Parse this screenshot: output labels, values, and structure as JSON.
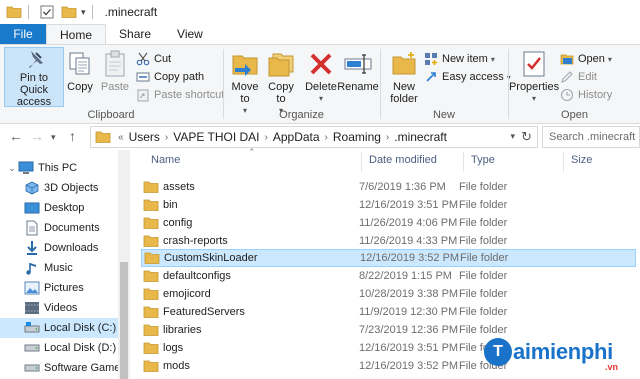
{
  "window": {
    "title": ".minecraft"
  },
  "tabs": [
    {
      "label": "File",
      "active": false
    },
    {
      "label": "Home",
      "active": true
    },
    {
      "label": "Share",
      "active": false
    },
    {
      "label": "View",
      "active": false
    }
  ],
  "ribbon": {
    "clipboard": {
      "label": "Clipboard",
      "pin_label": "Pin to Quick access",
      "copy_label": "Copy",
      "paste_label": "Paste",
      "cut_label": "Cut",
      "copy_path_label": "Copy path",
      "paste_shortcut_label": "Paste shortcut"
    },
    "organize": {
      "label": "Organize",
      "move_to_label": "Move to",
      "copy_to_label": "Copy to",
      "delete_label": "Delete",
      "rename_label": "Rename"
    },
    "new": {
      "label": "New",
      "new_folder_label": "New folder",
      "new_item_label": "New item",
      "easy_access_label": "Easy access"
    },
    "open": {
      "label": "Open",
      "properties_label": "Properties",
      "open_label": "Open",
      "edit_label": "Edit",
      "history_label": "History"
    }
  },
  "address": {
    "breadcrumbs": [
      "Users",
      "VAPE THOI DAI",
      "AppData",
      "Roaming",
      ".minecraft"
    ],
    "overflow": "«",
    "search_placeholder": "Search .minecraft"
  },
  "nav_pane": {
    "items": [
      {
        "label": "This PC",
        "icon": "pc-icon",
        "indent": 0,
        "selected": false
      },
      {
        "label": "3D Objects",
        "icon": "3d-objects-icon",
        "indent": 1,
        "selected": false
      },
      {
        "label": "Desktop",
        "icon": "desktop-icon",
        "indent": 1,
        "selected": false
      },
      {
        "label": "Documents",
        "icon": "documents-icon",
        "indent": 1,
        "selected": false
      },
      {
        "label": "Downloads",
        "icon": "downloads-icon",
        "indent": 1,
        "selected": false
      },
      {
        "label": "Music",
        "icon": "music-icon",
        "indent": 1,
        "selected": false
      },
      {
        "label": "Pictures",
        "icon": "pictures-icon",
        "indent": 1,
        "selected": false
      },
      {
        "label": "Videos",
        "icon": "videos-icon",
        "indent": 1,
        "selected": false
      },
      {
        "label": "Local Disk (C:)",
        "icon": "drive-c-icon",
        "indent": 1,
        "selected": true
      },
      {
        "label": "Local Disk (D:)",
        "icon": "drive-icon",
        "indent": 1,
        "selected": false
      },
      {
        "label": "Software Games",
        "icon": "drive-icon",
        "indent": 1,
        "selected": false
      }
    ]
  },
  "file_list": {
    "columns": {
      "name": "Name",
      "date": "Date modified",
      "type": "Type",
      "size": "Size"
    },
    "rows": [
      {
        "name": "assets",
        "date": "7/6/2019 1:36 PM",
        "type": "File folder",
        "selected": false
      },
      {
        "name": "bin",
        "date": "12/16/2019 3:51 PM",
        "type": "File folder",
        "selected": false
      },
      {
        "name": "config",
        "date": "11/26/2019 4:06 PM",
        "type": "File folder",
        "selected": false
      },
      {
        "name": "crash-reports",
        "date": "11/26/2019 4:33 PM",
        "type": "File folder",
        "selected": false
      },
      {
        "name": "CustomSkinLoader",
        "date": "12/16/2019 3:52 PM",
        "type": "File folder",
        "selected": true
      },
      {
        "name": "defaultconfigs",
        "date": "8/22/2019 1:15 PM",
        "type": "File folder",
        "selected": false
      },
      {
        "name": "emojicord",
        "date": "10/28/2019 3:38 PM",
        "type": "File folder",
        "selected": false
      },
      {
        "name": "FeaturedServers",
        "date": "11/9/2019 12:30 PM",
        "type": "File folder",
        "selected": false
      },
      {
        "name": "libraries",
        "date": "7/23/2019 12:36 PM",
        "type": "File folder",
        "selected": false
      },
      {
        "name": "logs",
        "date": "12/16/2019 3:51 PM",
        "type": "File folder",
        "selected": false
      },
      {
        "name": "mods",
        "date": "12/16/2019 3:52 PM",
        "type": "File folder",
        "selected": false
      }
    ]
  },
  "watermark": {
    "brand": "aimienphi",
    "tld": ".vn"
  },
  "colors": {
    "file_tab": "#1979ca",
    "selection": "#cce8ff",
    "folder": "#e8b84a",
    "header_text": "#4d6082"
  }
}
